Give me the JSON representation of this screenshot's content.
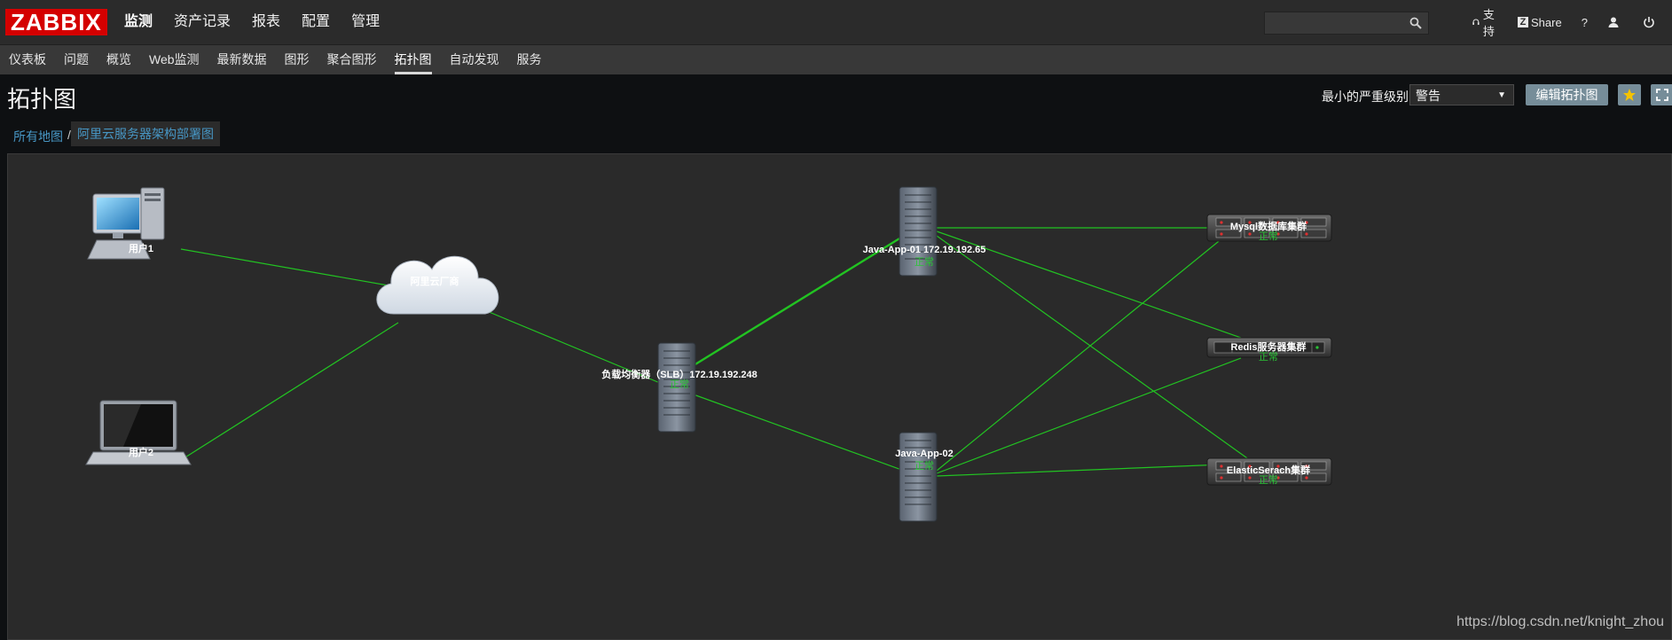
{
  "header": {
    "logo": "ZABBIX",
    "main_nav": [
      {
        "label": "监测",
        "active": true
      },
      {
        "label": "资产记录",
        "active": false
      },
      {
        "label": "报表",
        "active": false
      },
      {
        "label": "配置",
        "active": false
      },
      {
        "label": "管理",
        "active": false
      }
    ],
    "search_placeholder": "",
    "support": "支持",
    "share": "Share",
    "help": "?"
  },
  "sub_nav": [
    {
      "label": "仪表板"
    },
    {
      "label": "问题"
    },
    {
      "label": "概览"
    },
    {
      "label": "Web监测"
    },
    {
      "label": "最新数据"
    },
    {
      "label": "图形"
    },
    {
      "label": "聚合图形"
    },
    {
      "label": "拓扑图",
      "active": true
    },
    {
      "label": "自动发现"
    },
    {
      "label": "服务"
    }
  ],
  "page": {
    "title": "拓扑图",
    "severity_label": "最小的严重级别",
    "severity_value": "警告",
    "edit_button": "编辑拓扑图"
  },
  "breadcrumb": {
    "root": "所有地图",
    "separator": "/",
    "current": "阿里云服务器架构部署图"
  },
  "map": {
    "nodes": {
      "user1": {
        "label": "用户1",
        "status": ""
      },
      "user2": {
        "label": "用户2",
        "status": ""
      },
      "cloud": {
        "label": "阿里云厂商",
        "status": ""
      },
      "slb": {
        "label": "负载均衡器（SLB）172.19.192.248",
        "status": "正常"
      },
      "app01": {
        "label": "Java-App-01 172.19.192.65",
        "status": "正常"
      },
      "app02": {
        "label": "Java-App-02",
        "status": "正常"
      },
      "mysql": {
        "label": "Mysql数据库集群",
        "status": "正常"
      },
      "redis": {
        "label": "Redis服务器集群",
        "status": "正常"
      },
      "es": {
        "label": "ElasticSerach集群",
        "status": "正常"
      }
    },
    "colors": {
      "link": "#22c322",
      "status_ok": "#2ac336",
      "background": "#2a2a2a"
    }
  },
  "watermark": "https://blog.csdn.net/knight_zhou"
}
